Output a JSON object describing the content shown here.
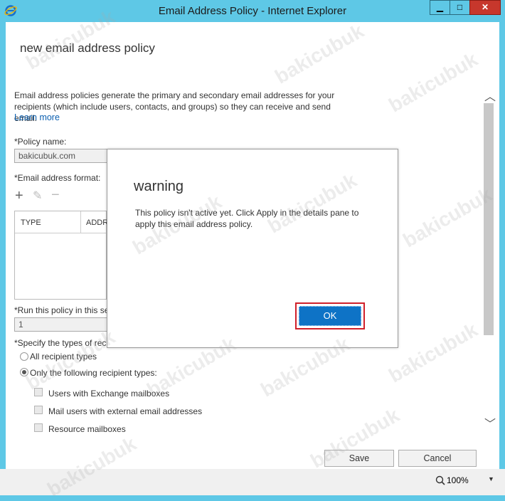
{
  "window": {
    "title": "Email Address Policy - Internet Explorer",
    "minimize": "▁",
    "maximize": "□",
    "close": "✕"
  },
  "page": {
    "title": "new email address policy",
    "description": "Email address policies generate the primary and secondary email addresses for your recipients (which include users, contacts, and groups) so they can receive and send email.",
    "learn_more": "Learn more"
  },
  "form": {
    "policy_name_label": "*Policy name:",
    "policy_name_value": "bakicubuk.com",
    "email_format_label": "*Email address format:",
    "table_columns": [
      "TYPE",
      "ADDR"
    ],
    "run_label": "*Run this policy in this se",
    "run_value": "1",
    "types_label": "*Specify the types of rec",
    "radio_all": "All recipient types",
    "radio_only": "Only the following recipient types:",
    "check_exchange": "Users with Exchange mailboxes",
    "check_mailusers": "Mail users with external email addresses",
    "check_resource": "Resource mailboxes"
  },
  "buttons": {
    "save": "Save",
    "cancel": "Cancel"
  },
  "status": {
    "zoom": "100%"
  },
  "dialog": {
    "title": "warning",
    "message": "This policy isn't active yet. Click Apply in the details pane to apply this email address policy.",
    "ok": "OK"
  },
  "watermark": "bakicubuk",
  "colors": {
    "titlebar": "#5ec8e6",
    "close_button": "#c7372c",
    "link": "#0b5fb0",
    "ok_button": "#0e73c6",
    "highlight_frame": "#d0202a"
  }
}
